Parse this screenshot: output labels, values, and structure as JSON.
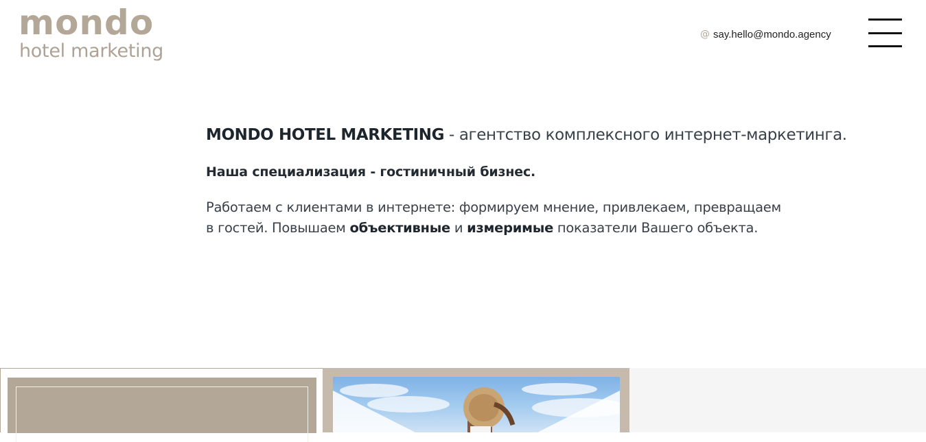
{
  "header": {
    "logo_word": "mondo",
    "logo_sub": "hotel marketing",
    "email_icon": "at-icon",
    "email": "say.hello@mondo.agency",
    "menu_icon": "hamburger-menu-icon"
  },
  "intro": {
    "brand": "MONDO HOTEL MARKETING",
    "tagline_rest": " - агентство комплексного интернет-маркетинга.",
    "specialization": "Наша специализация - гостиничный бизнес.",
    "about_part1": "Работаем с клиентами в интернете: формируем мнение, привлекаем, превращаем в гостей. Повышаем ",
    "about_bold1": "объективные",
    "about_part2": " и ",
    "about_bold2": "измеримые",
    "about_part3": " показатели Вашего объекта."
  },
  "colors": {
    "brand_taupe": "#b3a797",
    "text_dark": "#2a323a",
    "panel_light": "#f5f5f5"
  }
}
